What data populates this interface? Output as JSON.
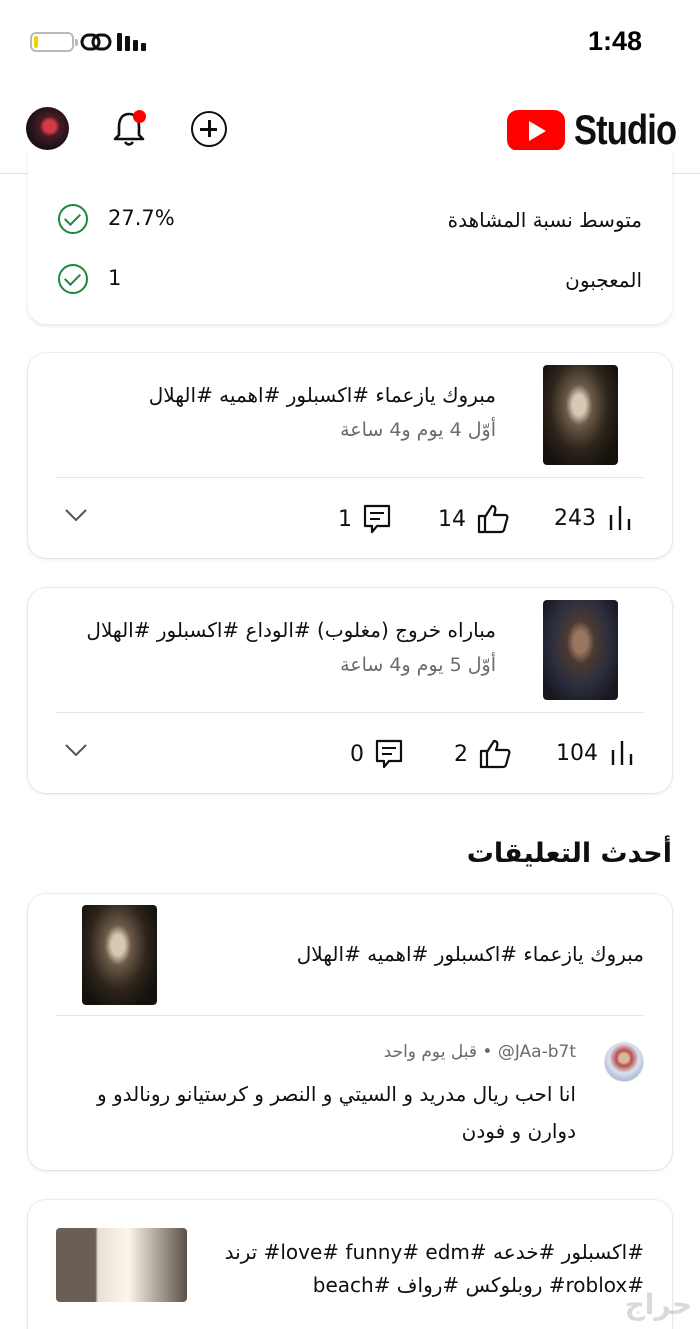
{
  "status_bar": {
    "time": "1:48",
    "battery_level": 0.1
  },
  "header": {
    "logo_text": "Studio",
    "has_notification": true,
    "brand_color": "#ff0000",
    "icons": [
      "avatar",
      "bell-icon",
      "create-icon",
      "youtube-logo-icon"
    ]
  },
  "metrics_card": {
    "rows": [
      {
        "label": "متوسط نسبة المشاهدة",
        "value": "27.7%",
        "status": "check-icon"
      },
      {
        "label": "المعجبون",
        "value": "1",
        "status": "check-icon"
      }
    ]
  },
  "videos": [
    {
      "title": "مبروك يازعماء #اكسبلور #اهميه #الهلال",
      "age": "أوّل 4 يوم و4 ساعة",
      "views": "243",
      "likes": "14",
      "comments": "1"
    },
    {
      "title": "مباراه خروج (مغلوب) #الوداع #اكسبلور #الهلال",
      "age": "أوّل 5 يوم و4 ساعة",
      "views": "104",
      "likes": "2",
      "comments": "0"
    }
  ],
  "latest_comments": {
    "title": "أحدث التعليقات",
    "items": [
      {
        "video_title": "مبروك يازعماء #اكسبلور #اهميه #الهلال",
        "author": "@JAa-b7t",
        "separator": "•",
        "time": "قبل يوم واحد",
        "text": "انا احب ريال مدريد و السيتي و النصر و كرستيانو رونالدو و دوارن و فودن"
      }
    ]
  },
  "partial_card": {
    "video_title_line1": "#اكسبلور #خدعه #love# funny# edm# ترند",
    "video_title_line2": "#roblox# روبلوكس #رواف #beach"
  },
  "watermark": "حراج"
}
